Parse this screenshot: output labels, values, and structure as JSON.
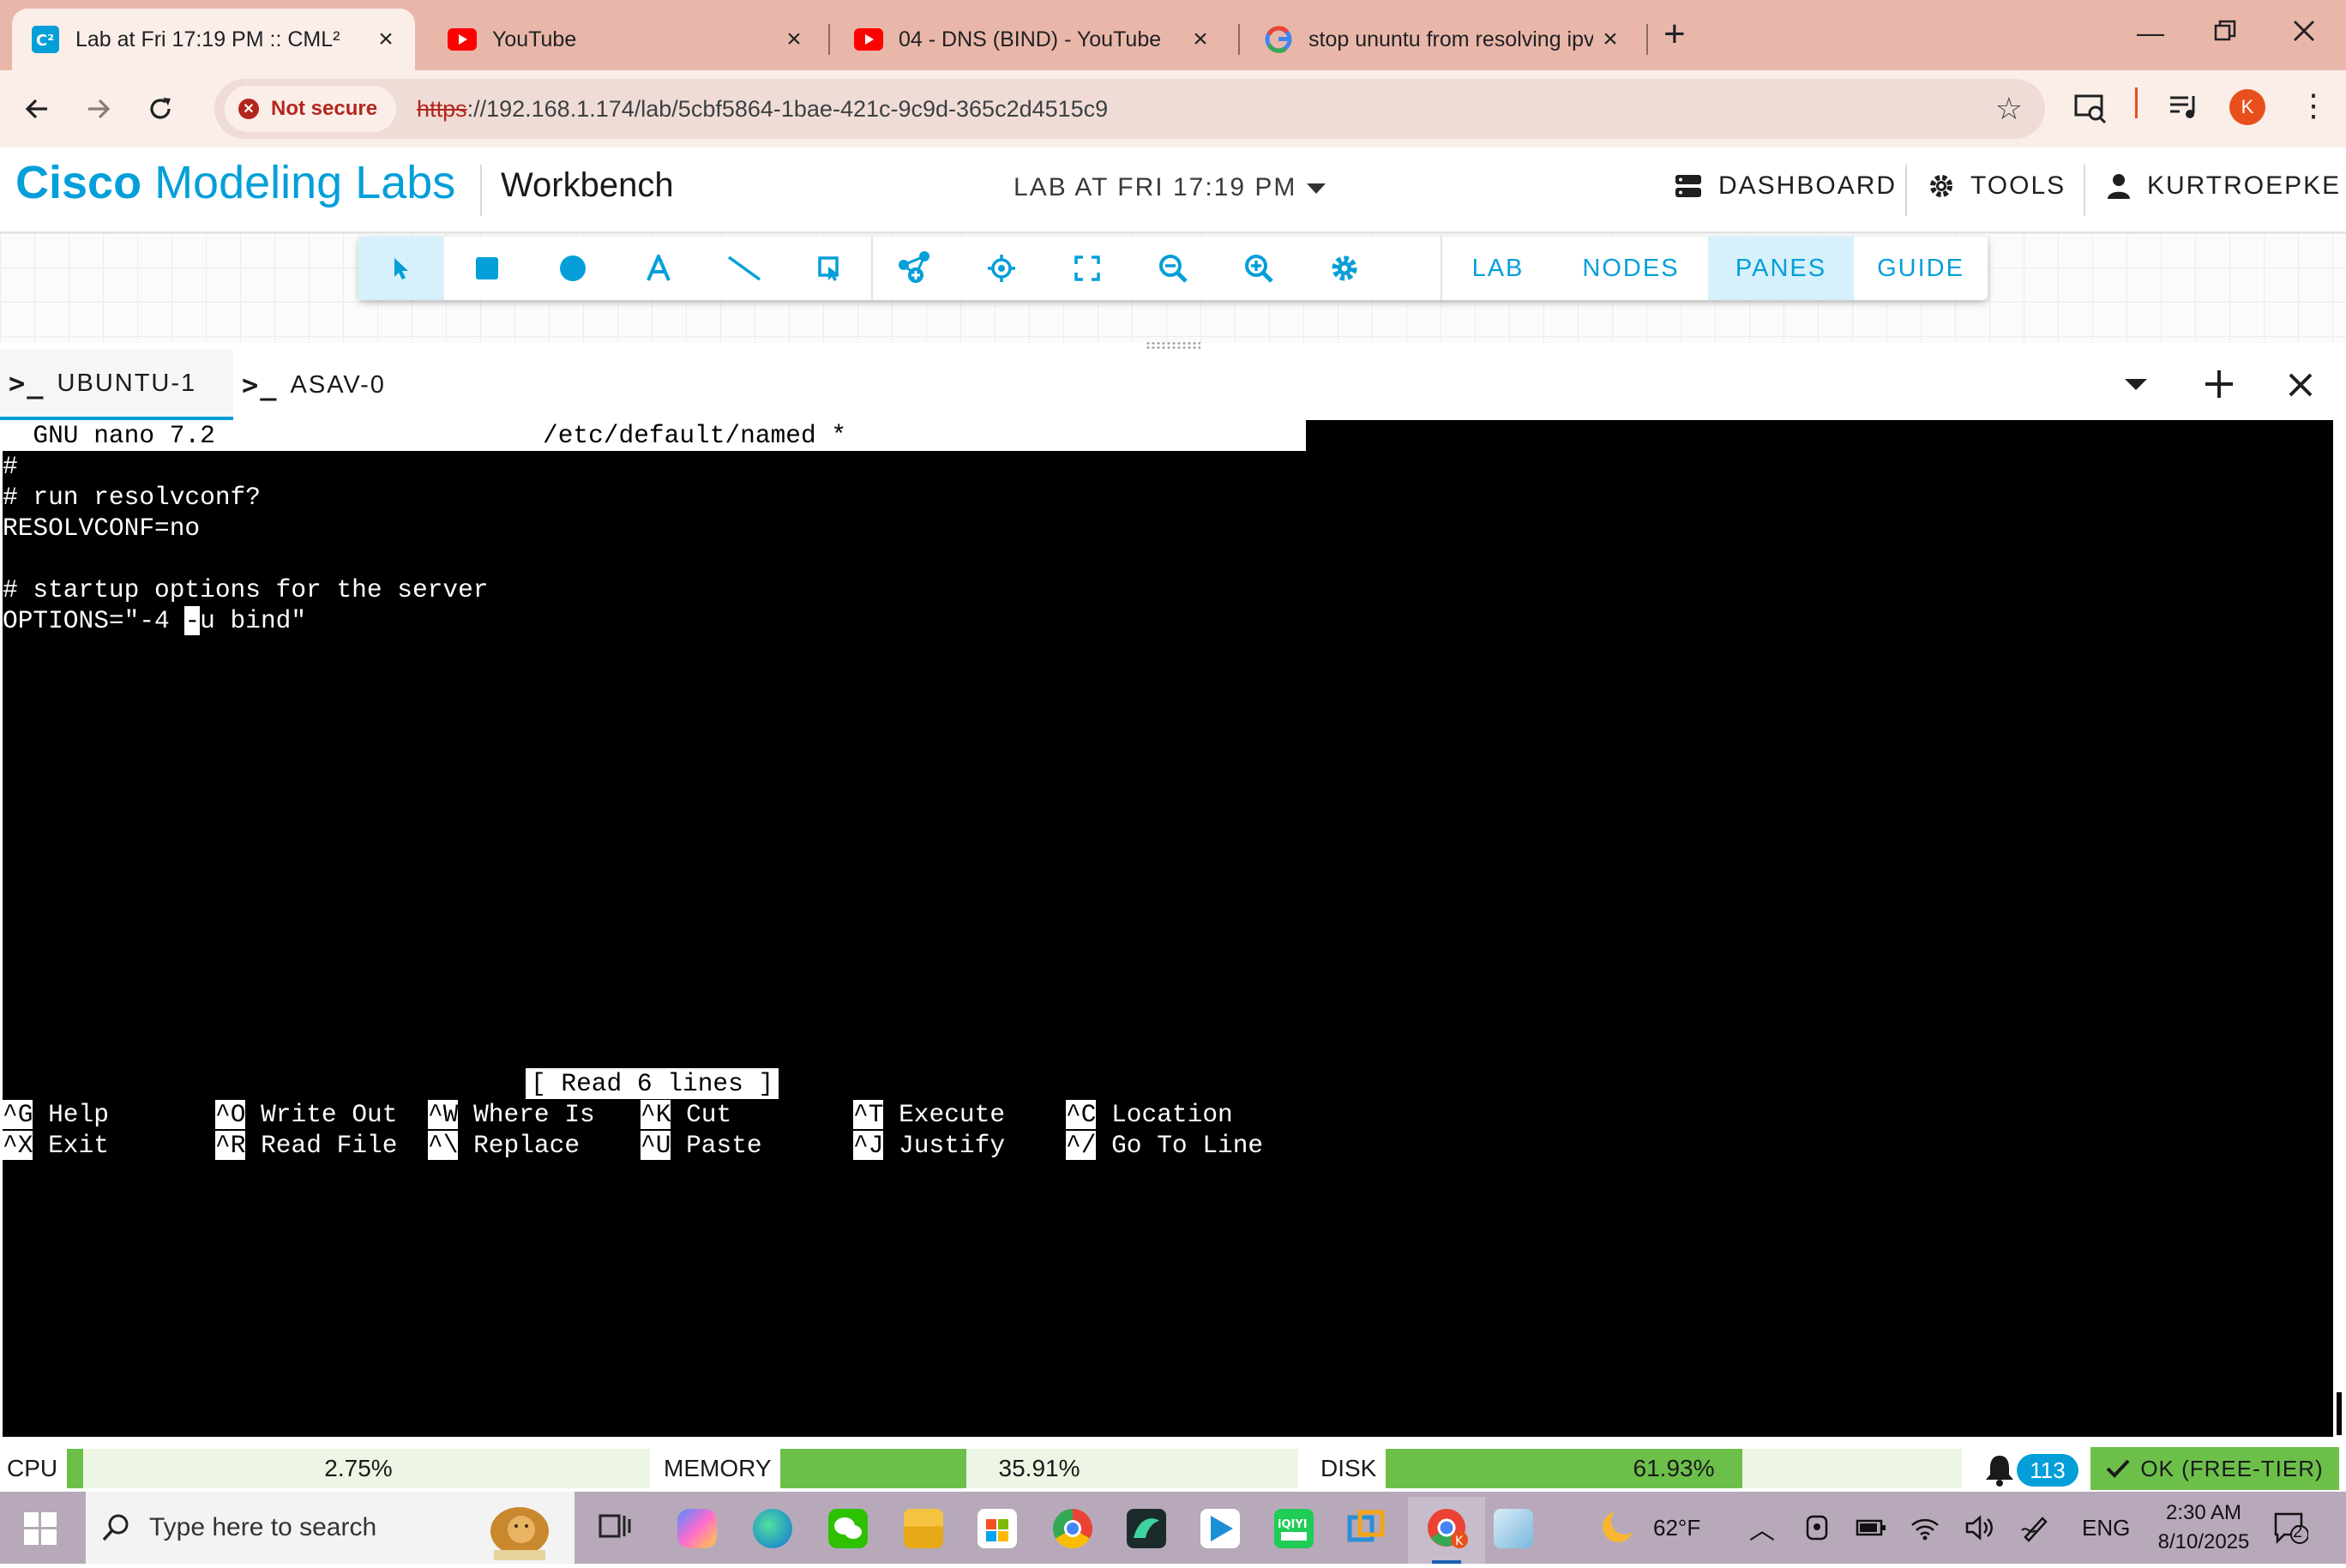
{
  "browser": {
    "tabs": [
      {
        "title": "Lab at Fri 17:19 PM :: CML²",
        "favicon": "cml-icon",
        "active": true
      },
      {
        "title": "YouTube",
        "favicon": "youtube-icon",
        "active": false
      },
      {
        "title": "04 - DNS (BIND) - YouTube",
        "favicon": "youtube-icon",
        "active": false
      },
      {
        "title": "stop ununtu from resolving ipv6",
        "favicon": "google-icon",
        "active": false
      }
    ],
    "security_chip": "Not secure",
    "url_scheme": "https",
    "url_rest": "://192.168.1.174/lab/5cbf5864-1bae-421c-9c9d-365c2d4515c9",
    "profile_initial": "K"
  },
  "header": {
    "brand_bold": "Cisco",
    "brand_light": " Modeling Labs",
    "workbench": "Workbench",
    "lab_title": "LAB AT FRI 17:19 PM",
    "nav": {
      "dashboard": "DASHBOARD",
      "tools": "TOOLS",
      "user": "KURTROEPKE"
    }
  },
  "toolbar": {
    "tools": [
      "select-icon",
      "rectangle-icon",
      "ellipse-icon",
      "text-icon",
      "line-icon",
      "annotation-select-icon",
      "add-node-icon",
      "center-icon",
      "fit-icon",
      "zoom-out-icon",
      "zoom-in-icon",
      "settings-icon"
    ],
    "tabs": {
      "lab": "LAB",
      "nodes": "NODES",
      "panes": "PANES",
      "guide": "GUIDE"
    },
    "selected_tab": "PANES"
  },
  "console": {
    "tabs": [
      {
        "label": "UBUNTU-1",
        "active": true
      },
      {
        "label": "ASAV-0",
        "active": false
      }
    ],
    "nano": {
      "title_left": "  GNU nano 7.2",
      "title_center": "/etc/default/named *",
      "lines": [
        "#",
        "# run resolvconf?",
        "RESOLVCONF=no",
        "",
        "# startup options for the server"
      ],
      "options_before": "OPTIONS=\"-4 ",
      "options_cursor": "-",
      "options_after": "u bind\"",
      "status": "[ Read 6 lines ]",
      "shortcuts_row1": [
        {
          "key": "^G",
          "label": "Help"
        },
        {
          "key": "^O",
          "label": "Write Out"
        },
        {
          "key": "^W",
          "label": "Where Is"
        },
        {
          "key": "^K",
          "label": "Cut"
        },
        {
          "key": "^T",
          "label": "Execute"
        },
        {
          "key": "^C",
          "label": "Location"
        }
      ],
      "shortcuts_row2": [
        {
          "key": "^X",
          "label": "Exit"
        },
        {
          "key": "^R",
          "label": "Read File"
        },
        {
          "key": "^\\",
          "label": "Replace"
        },
        {
          "key": "^U",
          "label": "Paste"
        },
        {
          "key": "^J",
          "label": "Justify"
        },
        {
          "key": "^/",
          "label": "Go To Line"
        }
      ]
    }
  },
  "status": {
    "cpu_label": "CPU",
    "cpu_value": "2.75%",
    "cpu_fraction": 0.0275,
    "memory_label": "MEMORY",
    "memory_value": "35.91%",
    "memory_fraction": 0.3591,
    "disk_label": "DISK",
    "disk_value": "61.93%",
    "disk_fraction": 0.6193,
    "notifications": "113",
    "license": "OK (FREE-TIER)"
  },
  "taskbar": {
    "search_placeholder": "Type here to search",
    "weather": "62°F",
    "language": "ENG",
    "time": "2:30 AM",
    "date": "8/10/2025",
    "notification_count": "2"
  },
  "colors": {
    "accent": "#049fd9",
    "tabbar": "#e9b7a9",
    "status_fill": "#6cc04a",
    "terminal_bg": "#000000"
  }
}
